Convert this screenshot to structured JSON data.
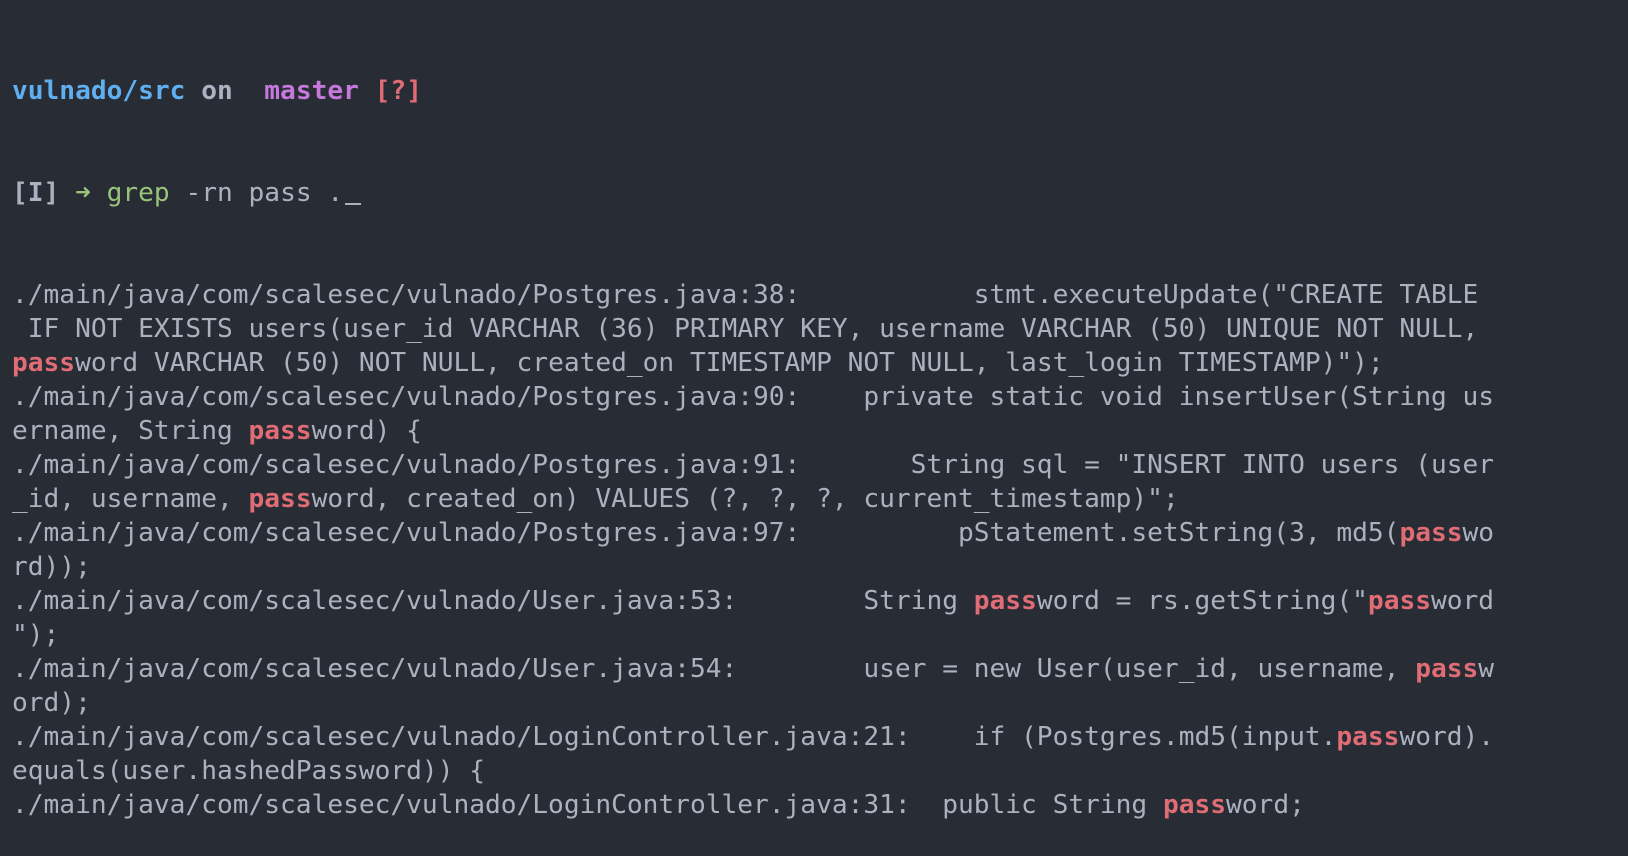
{
  "prompt": {
    "dir": "vulnado/src",
    "on": " on ",
    "branch_icon": "",
    "branch": " master ",
    "status": "[?]"
  },
  "command_line": {
    "mode": "[I]",
    "arrow": " ➜ ",
    "cmd": "grep",
    "args": " -rn pass ."
  },
  "output_lines": [
    [
      {
        "t": "./main/java/com/scalesec/vulnado/Postgres.java:38:           stmt.executeUpdate(\"CREATE TABLE",
        "m": false
      }
    ],
    [
      {
        "t": " IF NOT EXISTS users(user_id VARCHAR (36) PRIMARY KEY, username VARCHAR (50) UNIQUE NOT NULL,",
        "m": false
      }
    ],
    [
      {
        "t": "pass",
        "m": true
      },
      {
        "t": "word VARCHAR (50) NOT NULL, created_on TIMESTAMP NOT NULL, last_login TIMESTAMP)\");",
        "m": false
      }
    ],
    [
      {
        "t": "./main/java/com/scalesec/vulnado/Postgres.java:90:    private static void insertUser(String us",
        "m": false
      }
    ],
    [
      {
        "t": "ername, String ",
        "m": false
      },
      {
        "t": "pass",
        "m": true
      },
      {
        "t": "word) {",
        "m": false
      }
    ],
    [
      {
        "t": "./main/java/com/scalesec/vulnado/Postgres.java:91:       String sql = \"INSERT INTO users (user",
        "m": false
      }
    ],
    [
      {
        "t": "_id, username, ",
        "m": false
      },
      {
        "t": "pass",
        "m": true
      },
      {
        "t": "word, created_on) VALUES (?, ?, ?, current_timestamp)\";",
        "m": false
      }
    ],
    [
      {
        "t": "./main/java/com/scalesec/vulnado/Postgres.java:97:          pStatement.setString(3, md5(",
        "m": false
      },
      {
        "t": "pass",
        "m": true
      },
      {
        "t": "wo",
        "m": false
      }
    ],
    [
      {
        "t": "rd));",
        "m": false
      }
    ],
    [
      {
        "t": "./main/java/com/scalesec/vulnado/User.java:53:        String ",
        "m": false
      },
      {
        "t": "pass",
        "m": true
      },
      {
        "t": "word = rs.getString(\"",
        "m": false
      },
      {
        "t": "pass",
        "m": true
      },
      {
        "t": "word",
        "m": false
      }
    ],
    [
      {
        "t": "\");",
        "m": false
      }
    ],
    [
      {
        "t": "./main/java/com/scalesec/vulnado/User.java:54:        user = new User(user_id, username, ",
        "m": false
      },
      {
        "t": "pass",
        "m": true
      },
      {
        "t": "w",
        "m": false
      }
    ],
    [
      {
        "t": "ord);",
        "m": false
      }
    ],
    [
      {
        "t": "./main/java/com/scalesec/vulnado/LoginController.java:21:    if (Postgres.md5(input.",
        "m": false
      },
      {
        "t": "pass",
        "m": true
      },
      {
        "t": "word).",
        "m": false
      }
    ],
    [
      {
        "t": "equals(user.hashedPassword)) {",
        "m": false
      }
    ],
    [
      {
        "t": "./main/java/com/scalesec/vulnado/LoginController.java:31:  public String ",
        "m": false
      },
      {
        "t": "pass",
        "m": true
      },
      {
        "t": "word;",
        "m": false
      }
    ]
  ],
  "colors": {
    "background": "#282c34",
    "foreground": "#abb2bf",
    "dir": "#61afef",
    "branch": "#c678dd",
    "status": "#e06c75",
    "match": "#e06c75",
    "command": "#98c379"
  }
}
